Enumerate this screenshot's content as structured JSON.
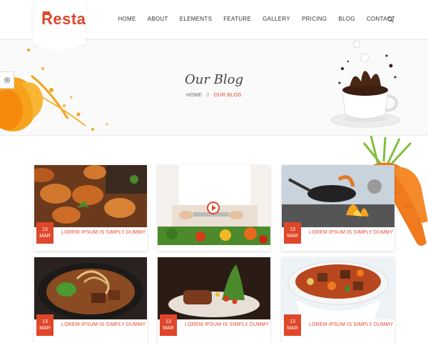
{
  "header": {
    "logo": "Resta",
    "nav": [
      "HOME",
      "ABOUT",
      "ELEMENTS",
      "FEATURE",
      "GALLERY",
      "PRICING",
      "BLOG",
      "CONTACT"
    ],
    "search_icon": "search-icon"
  },
  "hero": {
    "title": "Our Blog",
    "breadcrumb_home": "HOME",
    "breadcrumb_sep": "//",
    "breadcrumb_current": "OUR BLOG"
  },
  "colors": {
    "accent": "#e0462a",
    "text": "#333333",
    "hero_bg": "#fafafa"
  },
  "posts": [
    {
      "day": "13",
      "month": "MAR",
      "title": "LOREM IPSUM IS SIMPLY DUMMY",
      "image": "shrimp-dish"
    },
    {
      "day": "",
      "month": "",
      "title": "",
      "image": "chef-chopping-video"
    },
    {
      "day": "13",
      "month": "MAR",
      "title": "LOREM IPSUM IS SIMPLY DUMMY",
      "image": "wok-flame"
    },
    {
      "day": "13",
      "month": "MAR",
      "title": "LOREM IPSUM IS SIMPLY DUMMY",
      "image": "noodle-bowl"
    },
    {
      "day": "13",
      "month": "MAR",
      "title": "LOREM IPSUM IS SIMPLY DUMMY",
      "image": "steak-plate"
    },
    {
      "day": "13",
      "month": "MAR",
      "title": "LOREM IPSUM IS SIMPLY DUMMY",
      "image": "stew-bowl"
    }
  ]
}
